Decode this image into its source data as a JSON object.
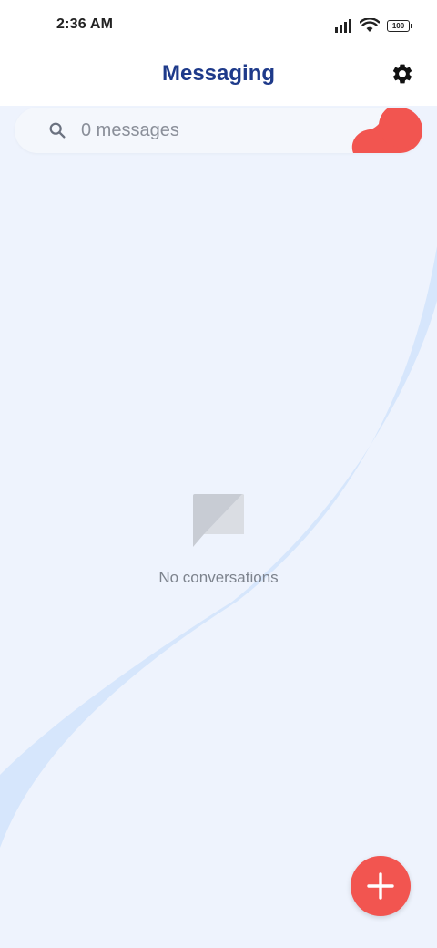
{
  "status_bar": {
    "time": "2:36 AM",
    "battery_level": "100",
    "icons": [
      "signal-icon",
      "wifi-icon",
      "battery-icon"
    ]
  },
  "app_bar": {
    "title": "Messaging",
    "settings_icon": "gear-icon"
  },
  "search": {
    "placeholder": "0 messages",
    "icon": "search-icon"
  },
  "empty_state": {
    "icon": "chat-bubble-icon",
    "text": "No conversations"
  },
  "fab": {
    "icon": "plus-icon"
  },
  "colors": {
    "accent": "#f25550",
    "title": "#1e3a8a",
    "background": "#eef3fd",
    "wave": "#d6e6fc"
  }
}
